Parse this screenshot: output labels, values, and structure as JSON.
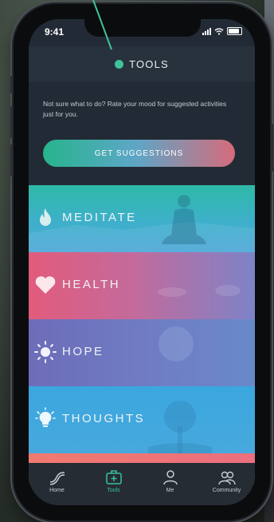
{
  "status_bar": {
    "time": "9:41"
  },
  "header": {
    "title": "TOOLS"
  },
  "intro": {
    "text": "Not sure what to do? Rate your mood for suggested activities just for you.",
    "button_label": "GET SUGGESTIONS"
  },
  "tools": [
    {
      "label": "MEDITATE",
      "icon": "flame-icon"
    },
    {
      "label": "HEALTH",
      "icon": "heart-icon"
    },
    {
      "label": "HOPE",
      "icon": "sun-icon"
    },
    {
      "label": "THOUGHTS",
      "icon": "lightbulb-icon"
    }
  ],
  "tabbar": {
    "items": [
      {
        "label": "Home",
        "icon": "home-icon"
      },
      {
        "label": "Tools",
        "icon": "toolbox-icon",
        "active": true
      },
      {
        "label": "Me",
        "icon": "person-icon"
      },
      {
        "label": "Community",
        "icon": "people-icon"
      }
    ]
  },
  "colors": {
    "accent": "#38c29a",
    "header_bg": "#28323d",
    "screen_bg": "#222b35",
    "tab_bar_bg": "#252c34"
  }
}
